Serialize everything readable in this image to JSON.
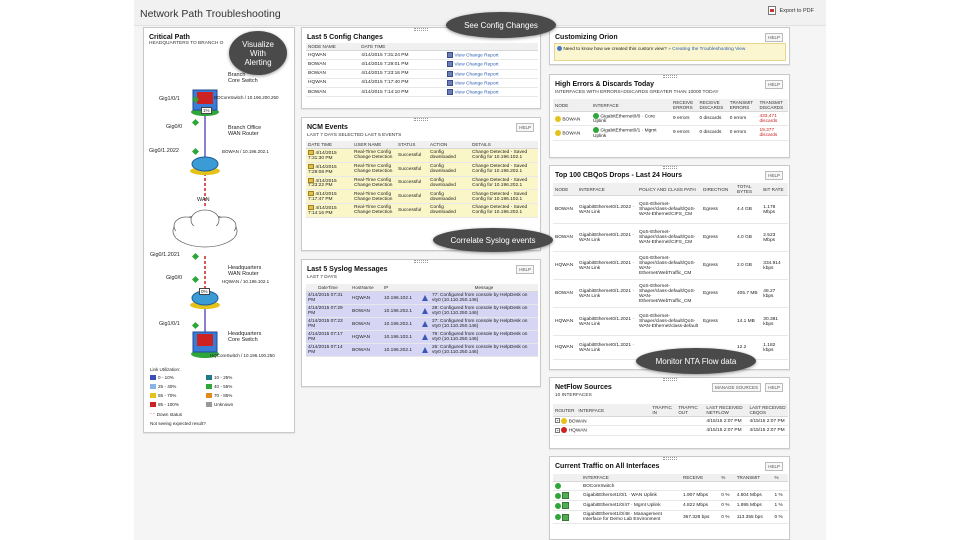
{
  "header": {
    "title": "Network Path Troubleshooting",
    "export_label": "Export to PDF"
  },
  "colors": {
    "callout_bg": "#4a4a4a",
    "row_yellow": "#faf6c8",
    "row_lavender": "#d6d6f4",
    "status_green": "#2fa63a",
    "status_yellow": "#e5c21a",
    "error_red": "#cc2222"
  },
  "callouts": {
    "visualize": "Visualize With Alerting",
    "config": "See Config Changes",
    "syslog": "Correlate Syslog events",
    "nta": "Monitor NTA Flow data"
  },
  "critical_path": {
    "title": "Critical Path",
    "subtitle": "HEADQUARTERS TO BRANCH O",
    "branch_core": {
      "name": "Branch Office Core Switch",
      "name_l1": "Branch",
      "name_l2": "Core Switch",
      "ip": "BOCoreSwitch / 10.196.200.250"
    },
    "branch_router": {
      "name_l1": "Branch Office",
      "name_l2": "WAN Router",
      "ip": "BOWAN / 10.196.202.1"
    },
    "wan_label": "WAN",
    "hq_router": {
      "name_l1": "Headquarters",
      "name_l2": "WAN Router",
      "ip": "HQWAN / 10.196.102.1"
    },
    "hq_core": {
      "name_l1": "Headquarters",
      "name_l2": "Core Switch",
      "ip": "HQCoreSwitch / 10.196.100.250"
    },
    "iface_1": "Gig1/0/1",
    "pct_1": "1%",
    "iface_2": "Gig0/0",
    "iface_3": "Gig0/1.2022",
    "iface_4": "Gig0/1.2021",
    "iface_5": "Gig0/0",
    "pct_2": "0%",
    "iface_6": "Gig1/0/1",
    "legend_title": "Link Utilization:",
    "legend": [
      {
        "label": "0 - 10%",
        "color": "#3a4fb8"
      },
      {
        "label": "10 - 25%",
        "color": "#1f7a8c"
      },
      {
        "label": "25 - 40%",
        "color": "#8ab4e8"
      },
      {
        "label": "40 - 55%",
        "color": "#2fa63a"
      },
      {
        "label": "55 - 70%",
        "color": "#e5c21a"
      },
      {
        "label": "70 - 85%",
        "color": "#e08a1a"
      },
      {
        "label": "85 - 100%",
        "color": "#cc2222"
      },
      {
        "label": "Unknown",
        "color": "#999999"
      }
    ],
    "down_status": "Down status",
    "not_seeing": "Not seeing expected result?"
  },
  "config_changes": {
    "title": "Last 5 Config Changes",
    "headers": [
      "NODE NAME",
      "DATE TIME",
      ""
    ],
    "rows": [
      {
        "node": "HQWAN",
        "time": "4/14/2015 7:31:24 PM",
        "action": "View Change Report"
      },
      {
        "node": "BOWAN",
        "time": "4/14/2015 7:29:01 PM",
        "action": "View Change Report"
      },
      {
        "node": "BOWAN",
        "time": "4/14/2015 7:23:16 PM",
        "action": "View Change Report"
      },
      {
        "node": "HQWAN",
        "time": "4/14/2015 7:17:40 PM",
        "action": "View Change Report"
      },
      {
        "node": "BOWAN",
        "time": "4/14/2015 7:14:10 PM",
        "action": "View Change Report"
      }
    ]
  },
  "ncm_events": {
    "title": "NCM Events",
    "subtitle": "LAST 7 DAYS SELECTED LAST 5 EVENTS",
    "help": "HELP",
    "headers": [
      "DATE TIME",
      "USER NAME",
      "STATUS",
      "ACTION",
      "DETAILS"
    ],
    "rows": [
      {
        "time": "4/14/2015 7:31:30 PM",
        "user": "Real-Time Config Change Detection",
        "status": "Successful",
        "action": "Config downloaded",
        "details": "Change Detected - Saved Config for 10.196.102.1"
      },
      {
        "time": "4/14/2015 7:29:08 PM",
        "user": "Real-Time Config Change Detection",
        "status": "Successful",
        "action": "Config downloaded",
        "details": "Change Detected - Saved Config for 10.196.202.1"
      },
      {
        "time": "4/14/2015 7:23:22 PM",
        "user": "Real-Time Config Change Detection",
        "status": "Successful",
        "action": "Config downloaded",
        "details": "Change Detected - Saved Config for 10.196.202.1"
      },
      {
        "time": "4/14/2015 7:17:47 PM",
        "user": "Real-Time Config Change Detection",
        "status": "Successful",
        "action": "Config downloaded",
        "details": "Change Detected - Saved Config for 10.196.102.1"
      },
      {
        "time": "4/14/2015 7:14:16 PM",
        "user": "Real-Time Config Change Detection",
        "status": "Successful",
        "action": "Config downloaded",
        "details": "Change Detected - Saved Config for 10.196.202.1"
      }
    ]
  },
  "syslog": {
    "title": "Last 5 Syslog Messages",
    "subtitle": "LAST 7 DAYS",
    "help": "HELP",
    "headers": [
      "DateTime",
      "HostName",
      "IP",
      "",
      "Message"
    ],
    "rows": [
      {
        "time": "4/14/2015 07:31 PM",
        "host": "HQWAN",
        "ip": "10.196.102.1",
        "msg": "77: Configured from console by HelpDesk on vty0 (10.110.250.146)"
      },
      {
        "time": "4/14/2015 07:29 PM",
        "host": "BOWAN",
        "ip": "10.196.202.1",
        "msg": "28: Configured from console by HelpDesk on vty0 (10.110.250.146)"
      },
      {
        "time": "4/14/2015 07:23 PM",
        "host": "BOWAN",
        "ip": "10.196.202.1",
        "msg": "27: Configured from console by HelpDesk on vty0 (10.110.250.146)"
      },
      {
        "time": "4/14/2015 07:17 PM",
        "host": "HQWAN",
        "ip": "10.196.102.1",
        "msg": "76: Configured from console by HelpDesk on vty0 (10.110.250.146)"
      },
      {
        "time": "4/14/2015 07:14 PM",
        "host": "BOWAN",
        "ip": "10.196.202.1",
        "msg": "26: Configured from console by HelpDesk on vty0 (10.110.250.146)"
      }
    ]
  },
  "customizing": {
    "title": "Customizing Orion",
    "help": "HELP",
    "question": "Need to know how we created this custom view?",
    "link": "» Creating the Troubleshooting View"
  },
  "errors": {
    "title": "High Errors & Discards Today",
    "subtitle": "INTERFACES WITH ERRORS+DISCARDS GREATER THAN 10000 TODAY",
    "help": "HELP",
    "headers": [
      "NODE",
      "INTERFACE",
      "RECEIVE ERRORS",
      "RECEIVE DISCARDS",
      "TRANSMIT ERRORS",
      "TRANSMIT DISCARDS"
    ],
    "rows": [
      {
        "node": "BOWAN",
        "iface": "GigabitEthernet0/0 · Core Uplink",
        "rx_err": "9 errors",
        "rx_disc": "0 discards",
        "tx_err": "0 errors",
        "tx_disc": "433,471 discards"
      },
      {
        "node": "BOWAN",
        "iface": "GigabitEthernet0/1 · Mgmt Uplink",
        "rx_err": "9 errors",
        "rx_disc": "0 discards",
        "tx_err": "0 errors",
        "tx_disc": "19,377 discards"
      }
    ]
  },
  "cbqos": {
    "title": "Top 100 CBQoS Drops - Last 24 Hours",
    "help": "HELP",
    "headers": [
      "NODE",
      "INTERFACE",
      "POLICY AND CLASS PATH",
      "DIRECTION",
      "TOTAL BYTES",
      "BIT RATE"
    ],
    "rows": [
      {
        "node": "BOWAN",
        "iface": "GigabitEthernet0/1.2022 · WAN Link",
        "policy": "QoS-Ethernet-Shaper/class-default/QoS-WAN-Ethernet/CIFS_CM",
        "dir": "Egress",
        "bytes": "4.4 GB",
        "rate": "1.178 Mbps"
      },
      {
        "node": "BOWAN",
        "iface": "GigabitEthernet0/1.2021 · WAN Link",
        "policy": "QoS-Ethernet-Shaper/class-default/QoS-WAN-Ethernet/CIFS_CM",
        "dir": "Egress",
        "bytes": "4.0 GB",
        "rate": "2.523 Mbps"
      },
      {
        "node": "HQWAN",
        "iface": "GigabitEthernet0/1.2021 · WAN Link",
        "policy": "QoS-Ethernet-Shaper/class-default/QoS-WAN-Ethernet/WebTraffic_CM",
        "dir": "Egress",
        "bytes": "2.0 GB",
        "rate": "334.914 kbps"
      },
      {
        "node": "BOWAN",
        "iface": "GigabitEthernet0/1.2021 · WAN Link",
        "policy": "QoS-Ethernet-Shaper/class-default/QoS-WAN-Ethernet/WebTraffic_CM",
        "dir": "Egress",
        "bytes": "405.7 MB",
        "rate": "48.27 kbps"
      },
      {
        "node": "HQWAN",
        "iface": "GigabitEthernet0/1.2021 · WAN Link",
        "policy": "QoS-Ethernet-Shaper/class-default/QoS-WAN-Ethernet/class-default",
        "dir": "Egress",
        "bytes": "14.1 MB",
        "rate": "30.381 kbps"
      },
      {
        "node": "HQWAN",
        "iface": "GigabitEthernet0/1.2021 · WAN Link",
        "policy": "",
        "dir": "",
        "bytes": "12.2",
        "rate": "1.182 kbps"
      }
    ]
  },
  "netflow": {
    "title": "NetFlow Sources",
    "subtitle": "10 INTERFACES",
    "manage": "MANAGE SOURCES",
    "help": "HELP",
    "headers": [
      "ROUTER",
      "INTERFACE",
      "TRAFFIC IN",
      "TRAFFIC OUT",
      "LAST RECEIVED NETFLOW",
      "LAST RECEIVED CBQOS"
    ],
    "rows": [
      {
        "router": "BOWAN",
        "netflow": "4/15/15 2:07 PM",
        "cbqos": "4/15/15 2:07 PM"
      },
      {
        "router": "HQWAN",
        "netflow": "4/15/15 2:07 PM",
        "cbqos": "4/15/15 2:07 PM"
      }
    ]
  },
  "traffic": {
    "title": "Current Traffic on All Interfaces",
    "help": "HELP",
    "headers": [
      "",
      "INTERFACE",
      "RECEIVE",
      "%",
      "TRANSMIT",
      "%"
    ],
    "group": "BOCoreSwitch",
    "rows": [
      {
        "iface": "GigabitEthernet1/0/1 · WAN Uplink",
        "rx": "1.907 Mbps",
        "rxp": "0 %",
        "tx": "4.804 Mbps",
        "txp": "1 %"
      },
      {
        "iface": "GigabitEthernet1/0/47 · Mgmt Uplink",
        "rx": "4.822 Mbps",
        "rxp": "0 %",
        "tx": "1.895 Mbps",
        "txp": "1 %"
      },
      {
        "iface": "GigabitEthernet1/0/48 · Management Interface for Demo Lab Environment",
        "rx": "367.328 bps",
        "rxp": "0 %",
        "tx": "113.355 bps",
        "txp": "0 %"
      }
    ]
  }
}
